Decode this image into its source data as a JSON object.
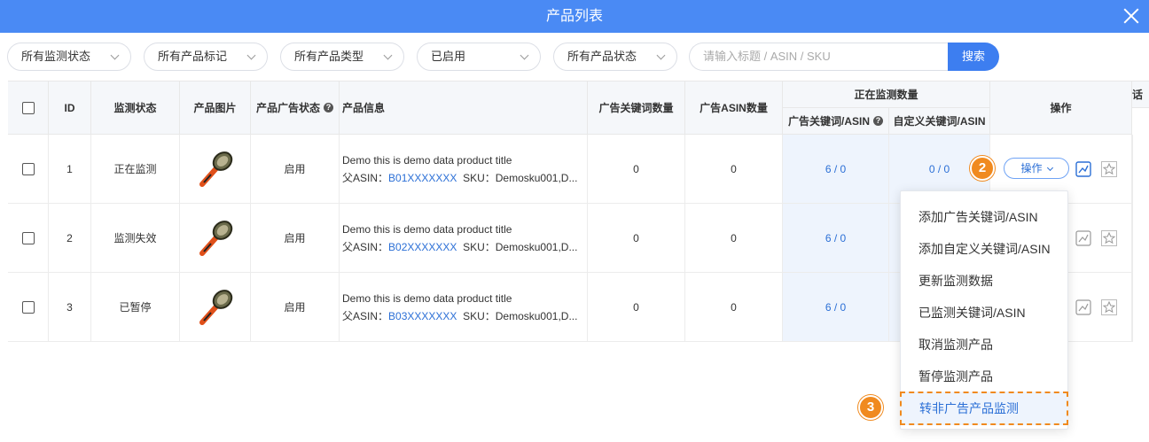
{
  "window": {
    "title": "产品列表"
  },
  "filters": [
    {
      "label": "所有监测状态"
    },
    {
      "label": "所有产品标记"
    },
    {
      "label": "所有产品类型"
    },
    {
      "label": "已启用"
    },
    {
      "label": "所有产品状态"
    }
  ],
  "search": {
    "placeholder": "请输入标题 / ASIN / SKU",
    "button": "搜索"
  },
  "table": {
    "headers": {
      "id": "ID",
      "monitor_status": "监测状态",
      "image": "产品图片",
      "ad_status": "产品广告状态",
      "info": "产品信息",
      "ad_kw_count": "广告关键词数量",
      "ad_asin_count": "广告ASIN数量",
      "monitoring_group": "正在监测数量",
      "ad_kw_asin": "广告关键词/ASIN",
      "custom_kw_asin": "自定义关键词/ASIN",
      "action": "操作",
      "overflow": "话"
    },
    "rows": [
      {
        "id": "1",
        "monitor_status": "正在监测",
        "ad_status": "启用",
        "title": "Demo this is demo data product title",
        "parent_label": "父ASIN：",
        "parent_asin": "B01XXXXXXX",
        "sku": "SKU：Demosku001,D...",
        "ad_kw_count": "0",
        "ad_asin_count": "0",
        "ad_kw_asin": "6 / 0",
        "custom_kw_asin": "0 / 0"
      },
      {
        "id": "2",
        "monitor_status": "监测失效",
        "ad_status": "启用",
        "title": "Demo this is demo data product title",
        "parent_label": "父ASIN：",
        "parent_asin": "B02XXXXXXX",
        "sku": "SKU：Demosku001,D...",
        "ad_kw_count": "0",
        "ad_asin_count": "0",
        "ad_kw_asin": "6 / 0",
        "custom_kw_asin": ""
      },
      {
        "id": "3",
        "monitor_status": "已暂停",
        "ad_status": "启用",
        "title": "Demo this is demo data product title",
        "parent_label": "父ASIN：",
        "parent_asin": "B03XXXXXXX",
        "sku": "SKU：Demosku001,D...",
        "ad_kw_count": "0",
        "ad_asin_count": "0",
        "ad_kw_asin": "6 / 0",
        "custom_kw_asin": ""
      }
    ]
  },
  "action_button": {
    "label": "操作"
  },
  "badges": {
    "step2": "2",
    "step3": "3"
  },
  "dropdown": {
    "items": [
      "添加广告关键词/ASIN",
      "添加自定义关键词/ASIN",
      "更新监测数据",
      "已监测关键词/ASIN",
      "取消监测产品",
      "暂停监测产品",
      "转非广告产品监测"
    ]
  },
  "colors": {
    "header_bar": "#4a8af4",
    "accent": "#2b6fd6",
    "badge": "#f08a1f"
  },
  "icons": [
    "close-icon",
    "chevron-down-icon",
    "help-icon",
    "chart-icon",
    "star-icon"
  ]
}
